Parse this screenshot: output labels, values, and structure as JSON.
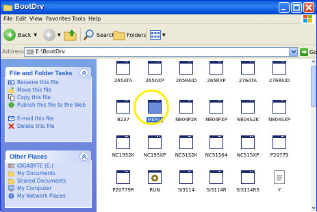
{
  "window": {
    "title": "BootDrv"
  },
  "menu": [
    "File",
    "Edit",
    "View",
    "Favorites",
    "Tools",
    "Help"
  ],
  "toolbar": {
    "back": "Back",
    "search": "Search",
    "folders": "Folders"
  },
  "address": {
    "label": "Address",
    "value": "E:\\BootDrv",
    "go": "Go"
  },
  "file_tasks": {
    "title": "File and Folder Tasks",
    "items": [
      "Rename this file",
      "Move this file",
      "Copy this file",
      "Publish this file to the Web",
      "E-mail this file",
      "Delete this file"
    ]
  },
  "other_places": {
    "title": "Other Places",
    "items": [
      "GIGABYTE (E:)",
      "My Documents",
      "Shared Documents",
      "My Computer",
      "My Network Places"
    ]
  },
  "files": [
    "265ATA",
    "265AXP",
    "265RAID",
    "265RXP",
    "276ATA",
    "276RAID",
    "8237",
    "MENU",
    "N804P2K",
    "N804PXP",
    "N804S2K",
    "N804SXP",
    "NC1952K",
    "NC195XP",
    "NC51S2K",
    "NC51564",
    "NC51SXP",
    "P20779",
    "P20779R",
    "RUN",
    "SI3114",
    "SI3114R",
    "SI3114R5",
    "Y"
  ],
  "selected_file": "MENU",
  "colors": {
    "titlebar": "#0a5fd8",
    "selection": "#316ac5",
    "highlight_ring": "#ffef00",
    "task_link": "#215dc6"
  }
}
